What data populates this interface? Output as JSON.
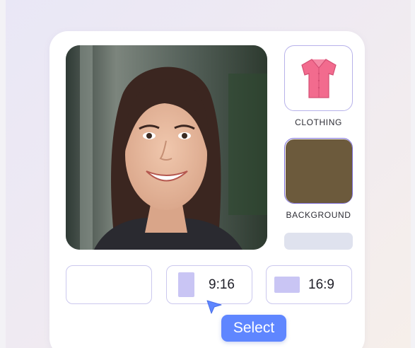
{
  "portrait": {
    "alt": "Portrait photo of a smiling woman"
  },
  "options": {
    "clothing": {
      "label": "CLOTHING",
      "icon": "shirt-icon",
      "shirt_color": "#f26b8e"
    },
    "background": {
      "label": "BACKGROUND",
      "swatch_color": "#6c5a3c"
    }
  },
  "aspect_ratios": [
    {
      "label": ""
    },
    {
      "label": "9:16"
    },
    {
      "label": "16:9"
    }
  ],
  "tooltip": {
    "label": "Select"
  },
  "colors": {
    "accent": "#5f86ff",
    "border": "#cbc8ee",
    "ratio_shape": "#c9c5f4"
  }
}
